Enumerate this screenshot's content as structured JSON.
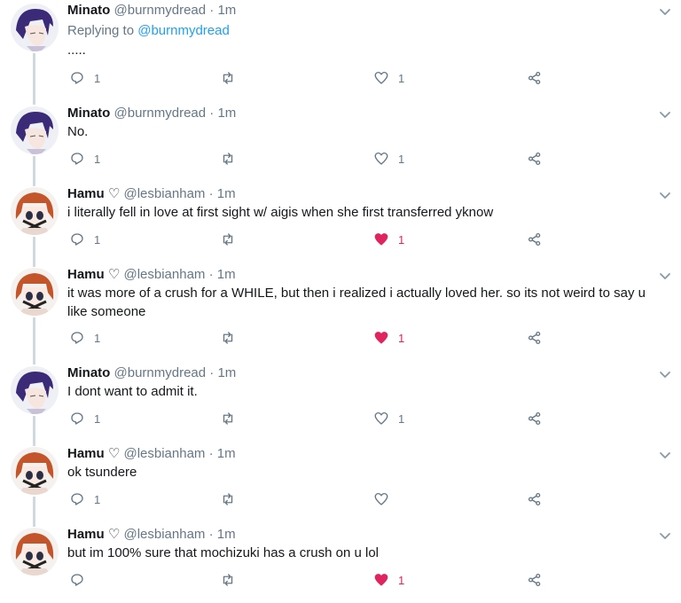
{
  "tweets": [
    {
      "name": "Minato",
      "handle": "@burnmydread",
      "time": "1m",
      "replying_prefix": "Replying to",
      "replying_to": "@burnmydread",
      "text": ".....",
      "reply_count": "1",
      "like_count": "1",
      "liked": false,
      "avatar": "minato"
    },
    {
      "name": "Minato",
      "handle": "@burnmydread",
      "time": "1m",
      "text": "No.",
      "reply_count": "1",
      "like_count": "1",
      "liked": false,
      "avatar": "minato"
    },
    {
      "name": "Hamu ♡",
      "handle": "@lesbianham",
      "time": "1m",
      "text": "i literally fell in love at first sight w/ aigis when she first transferred yknow",
      "reply_count": "1",
      "like_count": "1",
      "liked": true,
      "avatar": "hamu"
    },
    {
      "name": "Hamu ♡",
      "handle": "@lesbianham",
      "time": "1m",
      "text": "it was more of a crush for a WHILE, but then i realized i actually loved her. so its not weird to say u like someone",
      "reply_count": "1",
      "like_count": "1",
      "liked": true,
      "avatar": "hamu"
    },
    {
      "name": "Minato",
      "handle": "@burnmydread",
      "time": "1m",
      "text": "I dont want to admit it.",
      "reply_count": "1",
      "like_count": "1",
      "liked": false,
      "avatar": "minato"
    },
    {
      "name": "Hamu ♡",
      "handle": "@lesbianham",
      "time": "1m",
      "text": "ok tsundere",
      "reply_count": "1",
      "like_count": "",
      "liked": false,
      "avatar": "hamu"
    },
    {
      "name": "Hamu ♡",
      "handle": "@lesbianham",
      "time": "1m",
      "text": "but im 100% sure that mochizuki has a crush on u lol",
      "reply_count": "",
      "like_count": "1",
      "liked": true,
      "avatar": "hamu"
    }
  ],
  "colors": {
    "like": "#e0245e",
    "muted": "#657786",
    "link": "#1da1f2",
    "thread": "#cfd9de"
  },
  "icons": [
    "reply-icon",
    "retweet-icon",
    "heart-icon",
    "share-icon",
    "caret-down-icon"
  ]
}
